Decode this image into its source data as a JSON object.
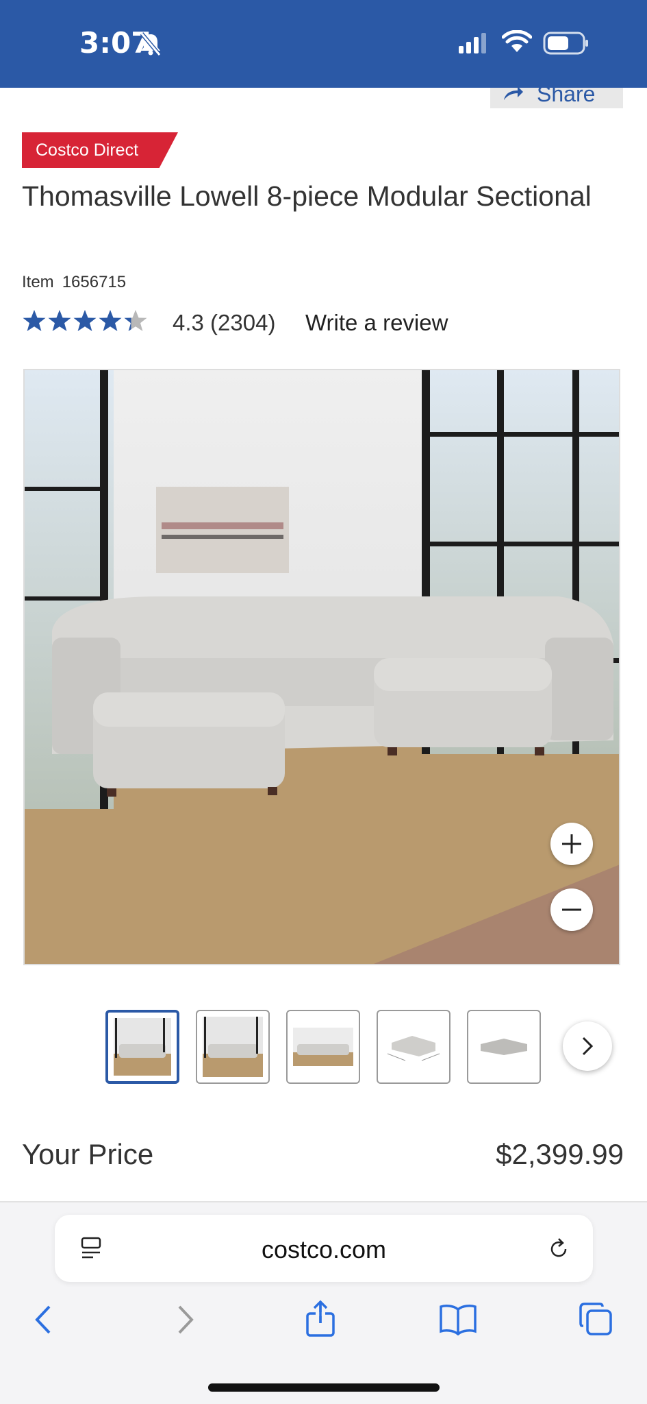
{
  "status_bar": {
    "time": "3:07"
  },
  "header": {
    "share_label": "Share"
  },
  "product": {
    "badge": "Costco Direct",
    "title": "Thomasville Lowell 8-piece Modular Sectional",
    "item_label": "Item",
    "item_number": "1656715",
    "rating": 4.3,
    "rating_text": "4.3",
    "review_count": "(2304)",
    "write_review": "Write a review"
  },
  "gallery": {
    "thumbnail_count": 5,
    "selected_index": 0
  },
  "pricing": {
    "label": "Your Price",
    "value": "$2,399.99"
  },
  "browser": {
    "url": "costco.com"
  },
  "colors": {
    "brand_blue": "#2b59a6",
    "badge_red": "#d72436"
  }
}
